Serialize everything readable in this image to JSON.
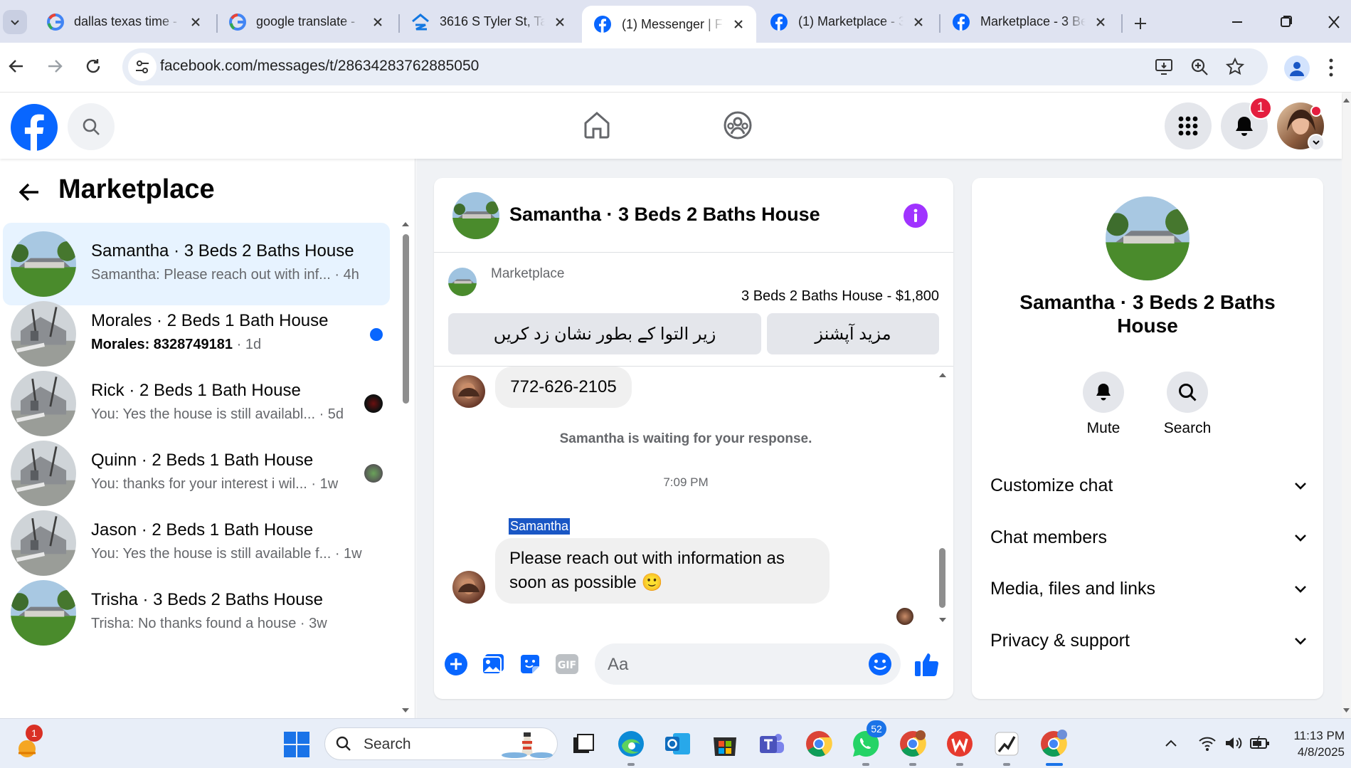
{
  "browser": {
    "tabs": [
      {
        "title": "dallas texas time -",
        "icon": "google-icon"
      },
      {
        "title": "google translate -",
        "icon": "google-icon"
      },
      {
        "title": "3616 S Tyler St, Tac",
        "icon": "zillow-icon"
      },
      {
        "title": "(1) Messenger | Fac",
        "icon": "facebook-icon",
        "active": true
      },
      {
        "title": "(1) Marketplace - 3",
        "icon": "facebook-icon"
      },
      {
        "title": "Marketplace - 3 Be",
        "icon": "facebook-icon"
      }
    ],
    "url": "facebook.com/messages/t/28634283762885050"
  },
  "header": {
    "notifications_badge": "1"
  },
  "sidebar": {
    "title": "Marketplace",
    "conversations": [
      {
        "name": "Samantha · 3 Beds 2 Baths House",
        "preview": "Samantha: Please reach out with inf... ",
        "time": "· 4h",
        "selected": true,
        "unread": false
      },
      {
        "name": "Morales · 2 Beds 1 Bath House",
        "preview": "Morales: 8328749181",
        "time": " · 1d",
        "selected": false,
        "unread": true
      },
      {
        "name": "Rick · 2 Beds 1 Bath House",
        "preview": "You: Yes the house is still availabl... ",
        "time": "· 5d",
        "selected": false,
        "unread": false
      },
      {
        "name": "Quinn · 2 Beds 1 Bath House",
        "preview": "You: thanks for your interest i wil... ",
        "time": "· 1w",
        "selected": false,
        "unread": false
      },
      {
        "name": "Jason · 2 Beds 1 Bath House",
        "preview": "You: Yes the house is still available f... ",
        "time": "· 1w",
        "selected": false,
        "unread": false
      },
      {
        "name": "Trisha · 3 Beds 2 Baths House",
        "preview": "Trisha: No thanks found a house ",
        "time": "· 3w",
        "selected": false,
        "unread": false
      }
    ]
  },
  "chat": {
    "title": "Samantha · 3 Beds 2 Baths House",
    "listing_source": "Marketplace",
    "listing_title": "3 Beds 2 Baths House - $1,800",
    "button_mark_pending": "زیر التوا کے بطور نشان زد کریں",
    "button_more_options": "مزید آپشنز",
    "messages": {
      "phone": "772-626-2105",
      "waiting_notice": "Samantha is waiting for your response.",
      "timestamp": "7:09 PM",
      "sender": "Samantha",
      "text_line1": "Please reach out with information as",
      "text_line2": "soon as possible 🙂"
    },
    "composer_placeholder": "Aa"
  },
  "info_panel": {
    "name_line1": "Samantha · 3 Beds 2 Baths",
    "name_line2": "House",
    "mute_label": "Mute",
    "search_label": "Search",
    "sections": [
      "Customize chat",
      "Chat members",
      "Media, files and links",
      "Privacy & support"
    ]
  },
  "taskbar": {
    "search_placeholder": "Search",
    "whatsapp_badge": "52",
    "weather_badge": "1",
    "time": "11:13 PM",
    "date": "4/8/2025"
  },
  "colors": {
    "facebook_blue": "#0866ff",
    "selected_row": "#e7f3ff",
    "purple_info": "#a033ff",
    "badge_red": "#e41e3f"
  }
}
